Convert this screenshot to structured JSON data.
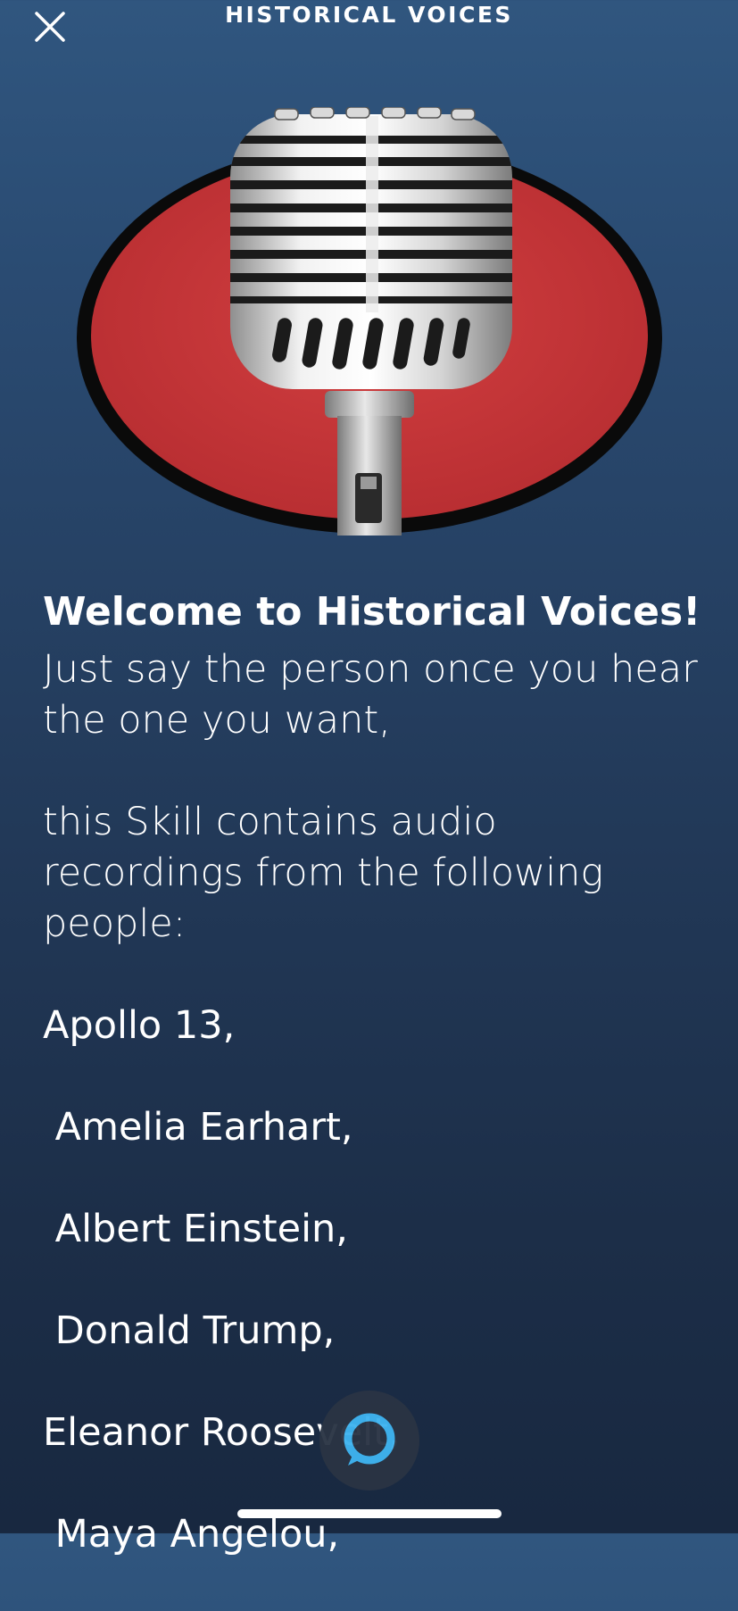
{
  "header": {
    "title": "HISTORICAL VOICES",
    "close_icon": "close-icon"
  },
  "hero": {
    "icon": "microphone-icon",
    "oval_color": "#c8373a",
    "rim_color": "#0a0a0a"
  },
  "content": {
    "welcome": "Welcome to Historical Voices!",
    "intro": "Just say the person once you hear the one you want,",
    "contains": "this Skill contains audio recordings from the following people:",
    "people": [
      "Apollo 13,",
      " Amelia Earhart,",
      " Albert Einstein,",
      " Donald Trump,",
      "Eleanor Roosevelt,",
      " Maya Angelou,"
    ]
  },
  "footer": {
    "alexa_icon": "alexa-ring-icon",
    "accent": "#3fb4f0"
  }
}
